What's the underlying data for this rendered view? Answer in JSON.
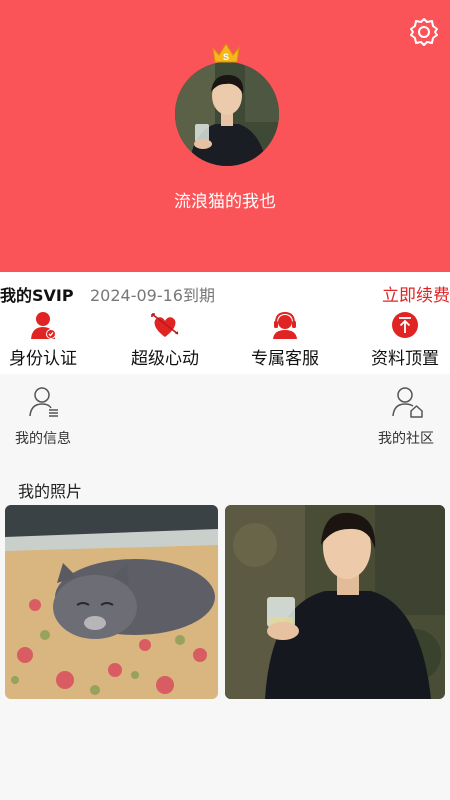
{
  "header": {
    "nickname": "流浪猫的我也",
    "colors": {
      "background": "#fb5458",
      "text": "#ffffff"
    },
    "icons": {
      "settings": "gear-icon",
      "crown": "crown-icon"
    }
  },
  "vip": {
    "title": "我的SVIP",
    "expiry": "2024-09-16到期",
    "renew_label": "立即续费",
    "renew_color": "#e02424",
    "perks": [
      {
        "label": "身份认证",
        "icon": "verified-user-icon"
      },
      {
        "label": "超级心动",
        "icon": "arrow-heart-icon"
      },
      {
        "label": "专属客服",
        "icon": "customer-service-icon"
      },
      {
        "label": "资料顶置",
        "icon": "pin-top-icon"
      }
    ]
  },
  "menu": {
    "my_info": {
      "label": "我的信息",
      "icon": "user-list-icon"
    },
    "my_community": {
      "label": "我的社区",
      "icon": "user-home-icon"
    }
  },
  "photos": {
    "title": "我的照片",
    "items": [
      {
        "subject": "cat-photo"
      },
      {
        "subject": "man-with-glass-photo"
      }
    ]
  }
}
